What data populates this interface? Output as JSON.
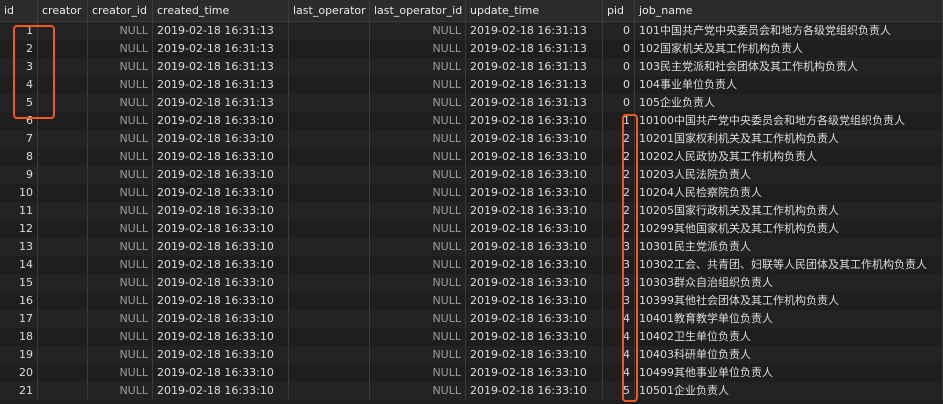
{
  "columns": [
    "id",
    "creator",
    "creator_id",
    "created_time",
    "last_operator",
    "last_operator_id",
    "update_time",
    "pid",
    "job_name"
  ],
  "rows": [
    {
      "id": "1",
      "creator_id": "NULL",
      "created_time": "2019-02-18 16:31:13",
      "last_operator_id": "NULL",
      "update_time": "2019-02-18 16:31:13",
      "pid": "0",
      "job_name": "101中国共产党中央委员会和地方各级党组织负责人"
    },
    {
      "id": "2",
      "creator_id": "NULL",
      "created_time": "2019-02-18 16:31:13",
      "last_operator_id": "NULL",
      "update_time": "2019-02-18 16:31:13",
      "pid": "0",
      "job_name": "102国家机关及其工作机构负责人"
    },
    {
      "id": "3",
      "creator_id": "NULL",
      "created_time": "2019-02-18 16:31:13",
      "last_operator_id": "NULL",
      "update_time": "2019-02-18 16:31:13",
      "pid": "0",
      "job_name": "103民主党派和社会团体及其工作机构负责人"
    },
    {
      "id": "4",
      "creator_id": "NULL",
      "created_time": "2019-02-18 16:31:13",
      "last_operator_id": "NULL",
      "update_time": "2019-02-18 16:31:13",
      "pid": "0",
      "job_name": "104事业单位负责人"
    },
    {
      "id": "5",
      "creator_id": "NULL",
      "created_time": "2019-02-18 16:31:13",
      "last_operator_id": "NULL",
      "update_time": "2019-02-18 16:31:13",
      "pid": "0",
      "job_name": "105企业负责人"
    },
    {
      "id": "6",
      "creator_id": "NULL",
      "created_time": "2019-02-18 16:33:10",
      "last_operator_id": "NULL",
      "update_time": "2019-02-18 16:33:10",
      "pid": "1",
      "job_name": "10100中国共产党中央委员会和地方各级党组织负责人"
    },
    {
      "id": "7",
      "creator_id": "NULL",
      "created_time": "2019-02-18 16:33:10",
      "last_operator_id": "NULL",
      "update_time": "2019-02-18 16:33:10",
      "pid": "2",
      "job_name": "10201国家权利机关及其工作机构负责人"
    },
    {
      "id": "8",
      "creator_id": "NULL",
      "created_time": "2019-02-18 16:33:10",
      "last_operator_id": "NULL",
      "update_time": "2019-02-18 16:33:10",
      "pid": "2",
      "job_name": "10202人民政协及其工作机构负责人"
    },
    {
      "id": "9",
      "creator_id": "NULL",
      "created_time": "2019-02-18 16:33:10",
      "last_operator_id": "NULL",
      "update_time": "2019-02-18 16:33:10",
      "pid": "2",
      "job_name": "10203人民法院负责人"
    },
    {
      "id": "10",
      "creator_id": "NULL",
      "created_time": "2019-02-18 16:33:10",
      "last_operator_id": "NULL",
      "update_time": "2019-02-18 16:33:10",
      "pid": "2",
      "job_name": "10204人民检察院负责人"
    },
    {
      "id": "11",
      "creator_id": "NULL",
      "created_time": "2019-02-18 16:33:10",
      "last_operator_id": "NULL",
      "update_time": "2019-02-18 16:33:10",
      "pid": "2",
      "job_name": "10205国家行政机关及其工作机构负责人"
    },
    {
      "id": "12",
      "creator_id": "NULL",
      "created_time": "2019-02-18 16:33:10",
      "last_operator_id": "NULL",
      "update_time": "2019-02-18 16:33:10",
      "pid": "2",
      "job_name": "10299其他国家机关及其工作机构负责人"
    },
    {
      "id": "13",
      "creator_id": "NULL",
      "created_time": "2019-02-18 16:33:10",
      "last_operator_id": "NULL",
      "update_time": "2019-02-18 16:33:10",
      "pid": "3",
      "job_name": "10301民主党派负责人"
    },
    {
      "id": "14",
      "creator_id": "NULL",
      "created_time": "2019-02-18 16:33:10",
      "last_operator_id": "NULL",
      "update_time": "2019-02-18 16:33:10",
      "pid": "3",
      "job_name": "10302工会、共青团、妇联等人民团体及其工作机构负责人"
    },
    {
      "id": "15",
      "creator_id": "NULL",
      "created_time": "2019-02-18 16:33:10",
      "last_operator_id": "NULL",
      "update_time": "2019-02-18 16:33:10",
      "pid": "3",
      "job_name": "10303群众自治组织负责人"
    },
    {
      "id": "16",
      "creator_id": "NULL",
      "created_time": "2019-02-18 16:33:10",
      "last_operator_id": "NULL",
      "update_time": "2019-02-18 16:33:10",
      "pid": "3",
      "job_name": "10399其他社会团体及其工作机构负责人"
    },
    {
      "id": "17",
      "creator_id": "NULL",
      "created_time": "2019-02-18 16:33:10",
      "last_operator_id": "NULL",
      "update_time": "2019-02-18 16:33:10",
      "pid": "4",
      "job_name": "10401教育教学单位负责人"
    },
    {
      "id": "18",
      "creator_id": "NULL",
      "created_time": "2019-02-18 16:33:10",
      "last_operator_id": "NULL",
      "update_time": "2019-02-18 16:33:10",
      "pid": "4",
      "job_name": "10402卫生单位负责人"
    },
    {
      "id": "19",
      "creator_id": "NULL",
      "created_time": "2019-02-18 16:33:10",
      "last_operator_id": "NULL",
      "update_time": "2019-02-18 16:33:10",
      "pid": "4",
      "job_name": "10403科研单位负责人"
    },
    {
      "id": "20",
      "creator_id": "NULL",
      "created_time": "2019-02-18 16:33:10",
      "last_operator_id": "NULL",
      "update_time": "2019-02-18 16:33:10",
      "pid": "4",
      "job_name": "10499其他事业单位负责人"
    },
    {
      "id": "21",
      "creator_id": "NULL",
      "created_time": "2019-02-18 16:33:10",
      "last_operator_id": "NULL",
      "update_time": "2019-02-18 16:33:10",
      "pid": "5",
      "job_name": "10501企业负责人"
    }
  ],
  "colors": {
    "highlight": "#f05a22",
    "background": "#1e1e1e"
  }
}
